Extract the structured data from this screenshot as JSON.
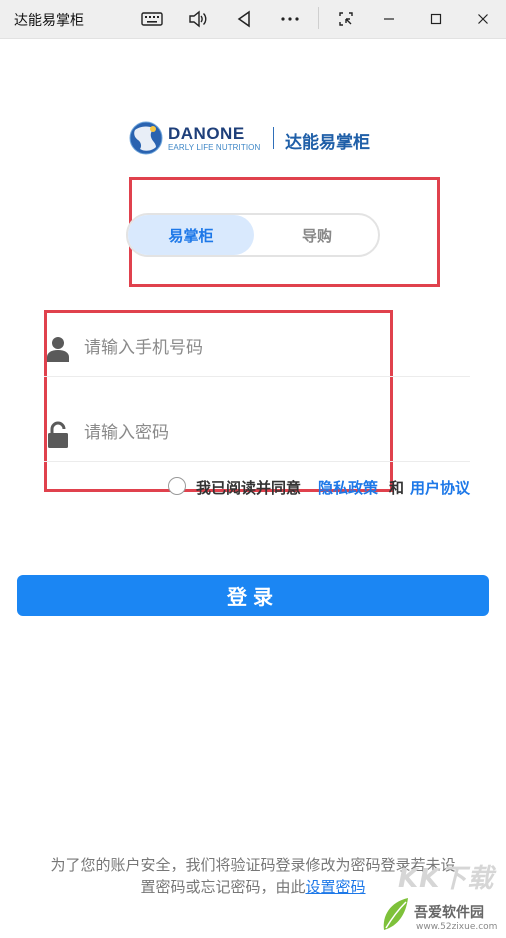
{
  "window": {
    "title": "达能易掌柜",
    "icons": [
      "keyboard-icon",
      "volume-icon",
      "back-triangle-icon",
      "more-icon",
      "snip-icon",
      "minimize-icon",
      "maximize-icon",
      "close-icon"
    ]
  },
  "logo": {
    "brand": "DANONE",
    "tagline": "EARLY LIFE NUTRITION",
    "app_name": "达能易掌柜"
  },
  "mode_toggle": {
    "options": [
      "易掌柜",
      "导购"
    ],
    "selected": "易掌柜"
  },
  "form": {
    "phone_placeholder": "请输入手机号码",
    "password_placeholder": "请输入密码"
  },
  "agreement": {
    "prefix": "我已阅读并同意",
    "privacy_link": "隐私政策",
    "and": "和",
    "terms_link": "用户协议"
  },
  "login_button": "登录",
  "footer": {
    "line1": "为了您的账户安全，我们将验证码登录修改为密码登录若未设",
    "line2": "置密码或忘记密码，由此",
    "link": "设置密码"
  },
  "watermark": {
    "logo_text": "KK下载",
    "site_name": "吾爱软件园",
    "site_url": "www.52zixue.com"
  },
  "colors": {
    "accent": "#1b86f3",
    "annotation_red": "#e0414d",
    "toggle_active_bg": "#d9e9fd"
  }
}
